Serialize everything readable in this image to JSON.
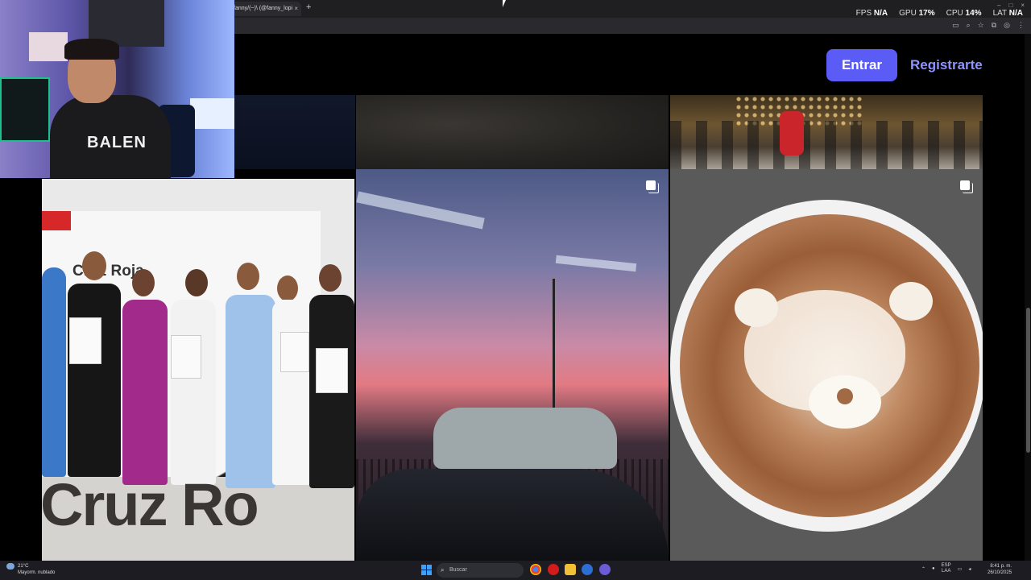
{
  "browser": {
    "tab_title": "fanny/(~)\\ (@fanny_lopi",
    "tab_close": "×",
    "new_tab": "+",
    "window_controls": [
      "–",
      "□",
      "×"
    ]
  },
  "overlay": {
    "fps_label": "FPS",
    "fps_value": "N/A",
    "gpu_label": "GPU",
    "gpu_value": "17",
    "cpu_label": "CPU",
    "cpu_value": "14",
    "lat_label": "LAT",
    "lat_value": "N/A",
    "percent": "%"
  },
  "site": {
    "login_button": "Entrar",
    "register_button": "Registrarte"
  },
  "photos": {
    "cruz_banner": "Cruz Roja",
    "cruz_letters": "Cruz Ro"
  },
  "webcam": {
    "shirt_text": "BALEN"
  },
  "taskbar": {
    "temperature": "21°C",
    "weather_desc": "Mayorm. nublado",
    "search_placeholder": "Buscar",
    "lang_top": "ESP",
    "lang_bottom": "LAA",
    "time": "8:41 p. m.",
    "date": "26/10/2025"
  },
  "colors": {
    "accent_button": "#5a5cf5",
    "register_link": "#8f93ff",
    "taskbar": "#1c1c22"
  }
}
